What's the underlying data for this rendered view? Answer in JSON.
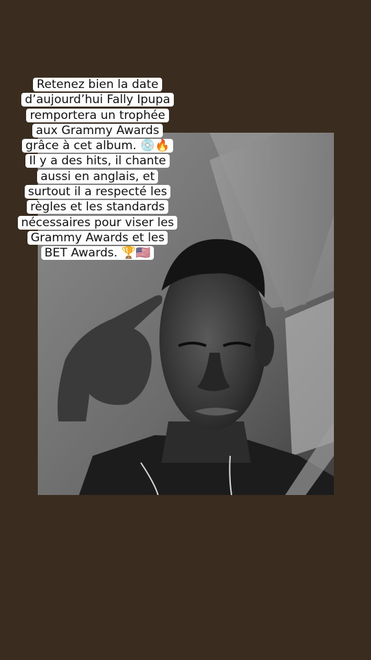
{
  "story": {
    "background_color": "#3a2c1e",
    "caption_lines": [
      "Retenez bien la date",
      "d’aujourd’hui Fally Ipupa",
      "remportera un trophée",
      "aux Grammy Awards",
      "grâce à cet album. 💿🔥",
      "Il y a des hits, il chante",
      "aussi en anglais, et",
      "surtout il a respecté les",
      "règles et les standards",
      "nécessaires pour viser les",
      "Grammy Awards et les",
      "BET Awards. 🏆🇺🇸"
    ],
    "photo": {
      "description_icon": "man-thinking-photo",
      "tone": "black-and-white"
    }
  }
}
